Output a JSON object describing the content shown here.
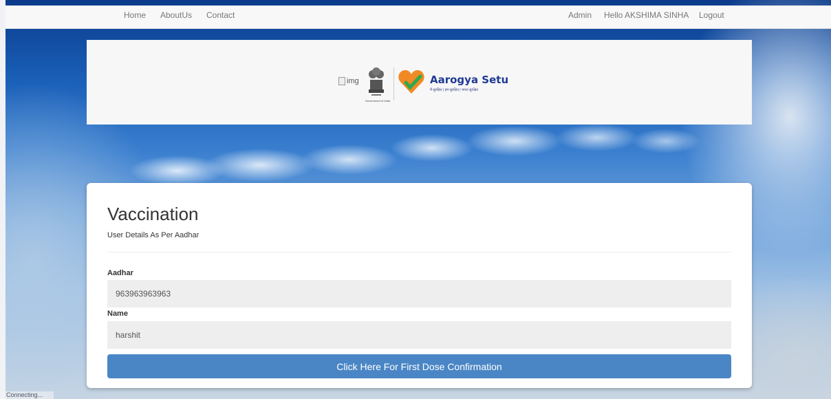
{
  "nav": {
    "left": [
      "Home",
      "AboutUs",
      "Contact"
    ],
    "right": [
      "Admin",
      "Hello AKSHIMA SINHA",
      "Logout"
    ]
  },
  "banner": {
    "broken_image_alt": "img",
    "emblem_caption": "Government of India",
    "brand_name": "Aarogya Setu",
    "brand_tagline": "मैं सुरक्षित | हम सुरक्षित | भारत सुरक्षित"
  },
  "card": {
    "title": "Vaccination",
    "subtitle": "User Details As Per Aadhar",
    "fields": [
      {
        "label": "Aadhar",
        "value": "963963963963"
      },
      {
        "label": "Name",
        "value": "harshit"
      }
    ],
    "button_label": "Click Here For First Dose Confirmation"
  },
  "status_bar": "Connecting...",
  "colors": {
    "button": "#4a86c5",
    "brand_blue": "#1f3a93",
    "heart_orange": "#f08a24",
    "check_green": "#2fa84f"
  },
  "icons": [
    "broken-image-icon",
    "state-emblem-icon",
    "aarogya-setu-heart-icon"
  ]
}
